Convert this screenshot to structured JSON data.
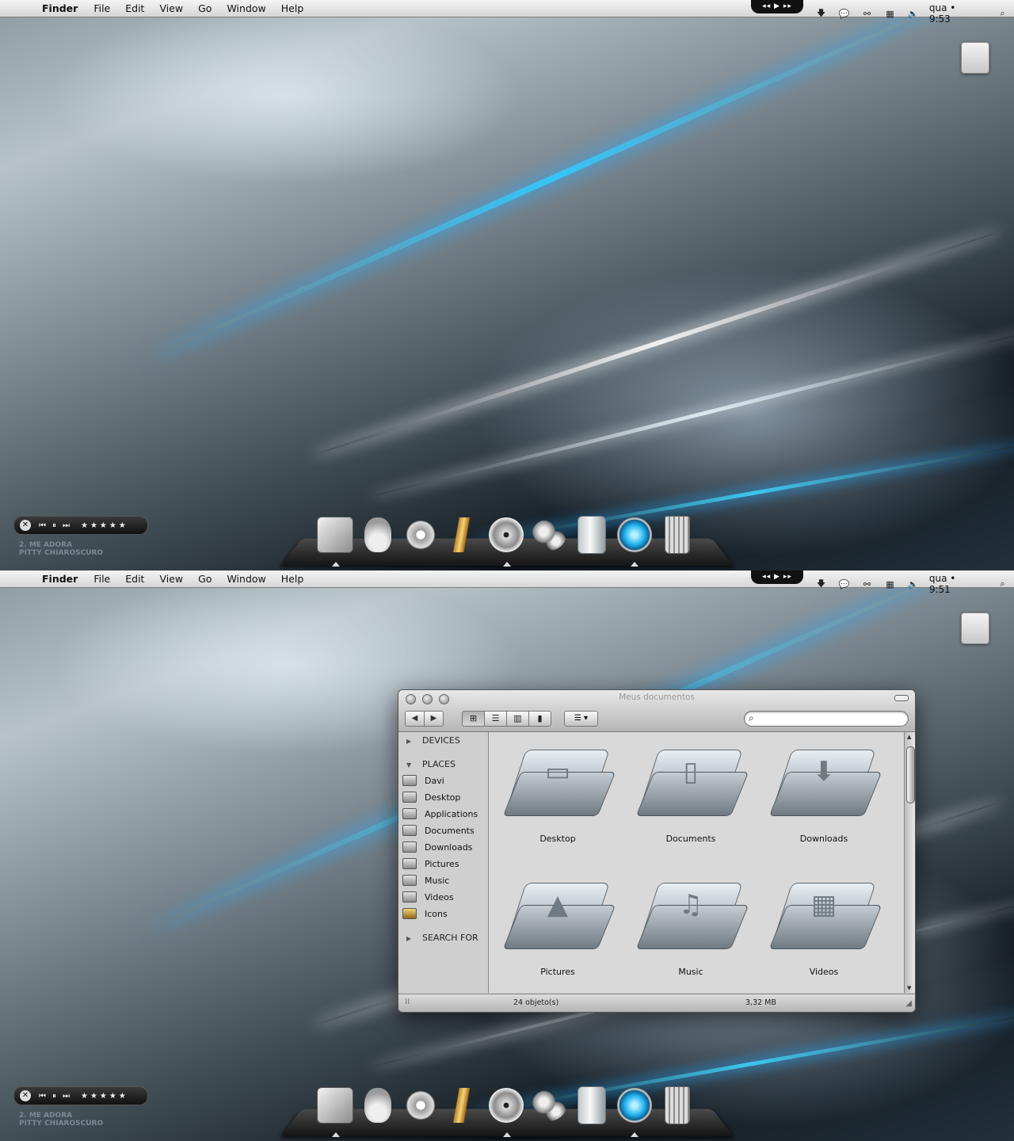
{
  "screens": [
    {
      "menubar": {
        "app": "Finder",
        "menus": [
          "File",
          "Edit",
          "View",
          "Go",
          "Window",
          "Help"
        ],
        "media": "◂◂ ▶ ▸▸",
        "clock": "qua • 9:53"
      }
    },
    {
      "menubar": {
        "app": "Finder",
        "menus": [
          "File",
          "Edit",
          "View",
          "Go",
          "Window",
          "Help"
        ],
        "media": "◂◂ ▶ ▸▸",
        "clock": "qua • 9:51"
      }
    }
  ],
  "player": {
    "controls": [
      "⏮",
      "⏸",
      "⏭"
    ],
    "rating": "★★★★★",
    "track": "2. ME ADORA",
    "artist": "PITTY CHIAROSCURO"
  },
  "dock_icons": [
    "folder-icon",
    "adium-duck-icon",
    "utility-gear-icon",
    "bullets-icon",
    "dvd-player-icon",
    "system-preferences-icon",
    "prism-icon",
    "time-machine-orb-icon",
    "trash-icon"
  ],
  "finder": {
    "title": "Meus documentos",
    "sidebar": {
      "devices": "DEVICES",
      "places": "PLACES",
      "items": [
        "Davi",
        "Desktop",
        "Applications",
        "Documents",
        "Downloads",
        "Pictures",
        "Music",
        "Videos",
        "Icons"
      ],
      "search_for": "SEARCH FOR"
    },
    "folders": [
      {
        "label": "Desktop",
        "glyph": "▭"
      },
      {
        "label": "Documents",
        "glyph": "▯"
      },
      {
        "label": "Downloads",
        "glyph": "⬇"
      },
      {
        "label": "Pictures",
        "glyph": "▲"
      },
      {
        "label": "Music",
        "glyph": "♫"
      },
      {
        "label": "Videos",
        "glyph": "▦"
      }
    ],
    "status": {
      "count": "24 objeto(s)",
      "size": "3,32 MB"
    }
  }
}
